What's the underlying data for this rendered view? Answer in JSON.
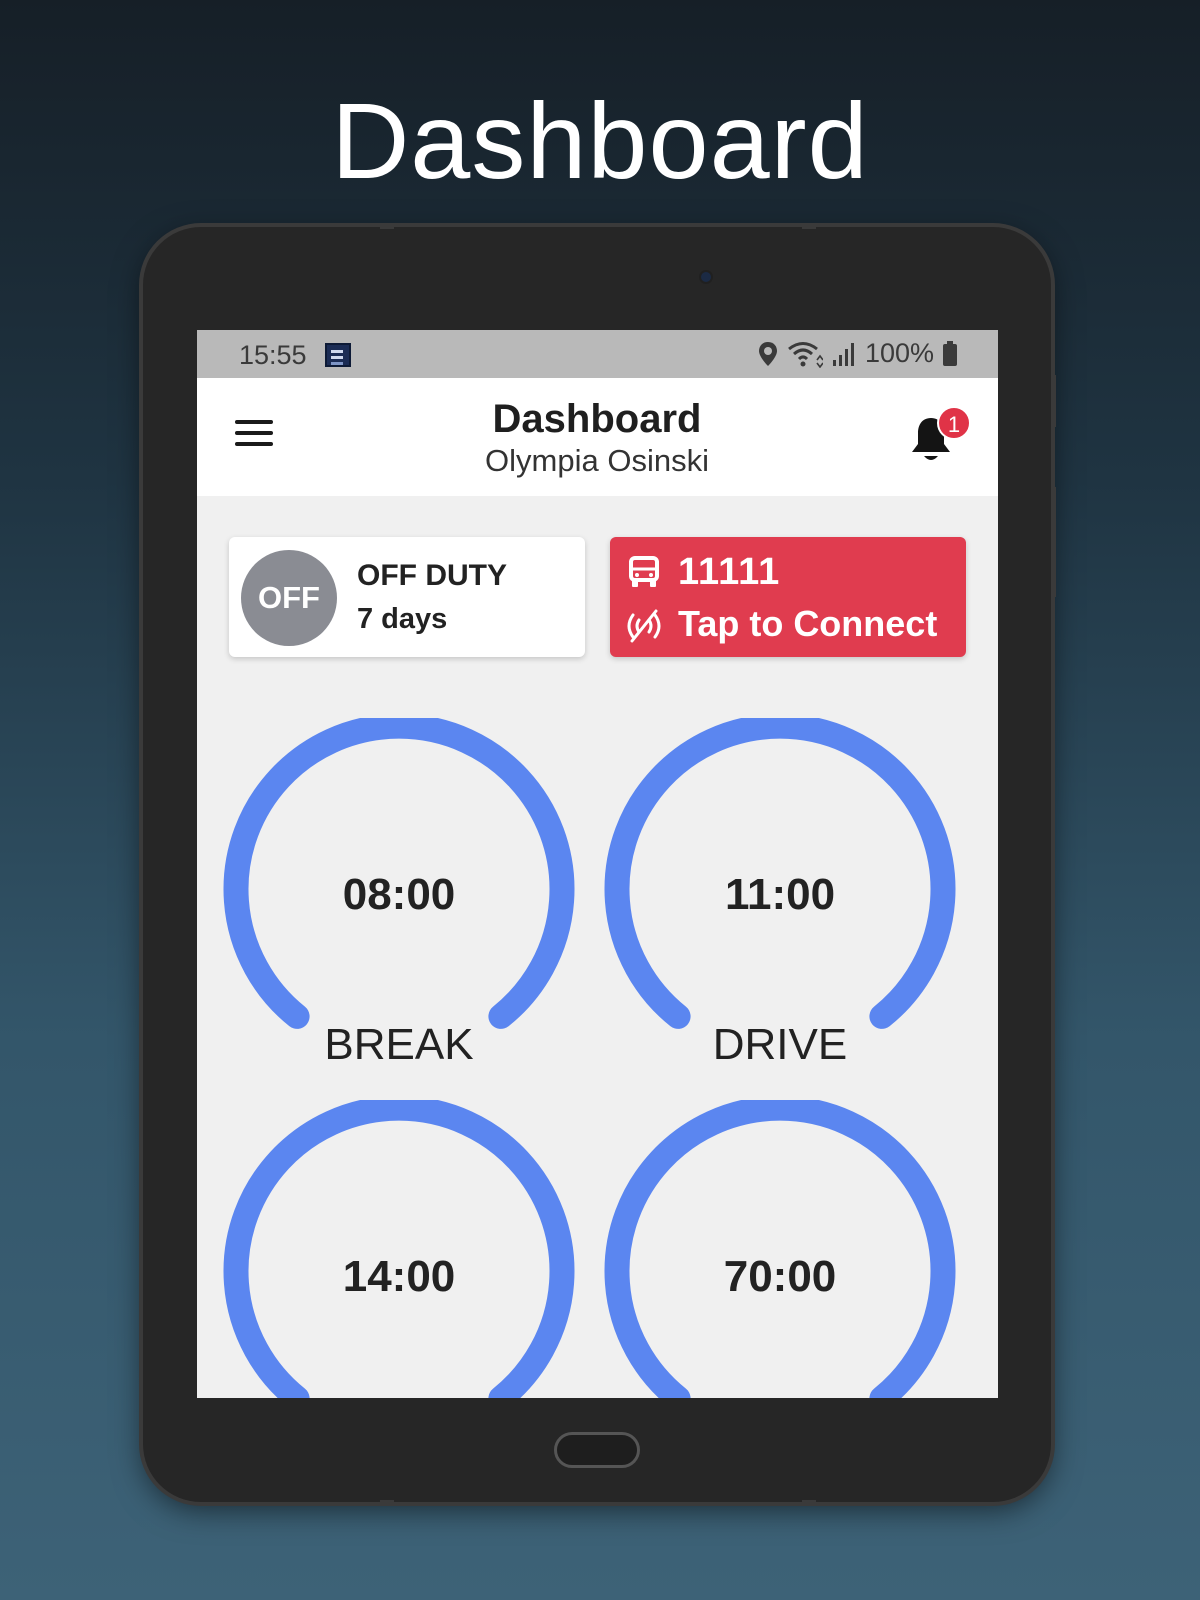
{
  "hero": {
    "title": "Dashboard"
  },
  "status_bar": {
    "time": "15:55",
    "battery": "100%"
  },
  "app_bar": {
    "title": "Dashboard",
    "subtitle": "Olympia Osinski",
    "notification_count": "1"
  },
  "duty": {
    "badge": "OFF",
    "status": "OFF DUTY",
    "duration": "7 days"
  },
  "vehicle": {
    "number": "11111",
    "connect_label": "Tap to Connect"
  },
  "timers": [
    {
      "value": "08:00",
      "label": "BREAK"
    },
    {
      "value": "11:00",
      "label": "DRIVE"
    },
    {
      "value": "14:00",
      "label": ""
    },
    {
      "value": "70:00",
      "label": ""
    }
  ],
  "colors": {
    "gauge_arc": "#5b86f0",
    "connect_card": "#e03c4f",
    "notification_badge": "#e03347",
    "duty_circle": "#8a8c93"
  }
}
